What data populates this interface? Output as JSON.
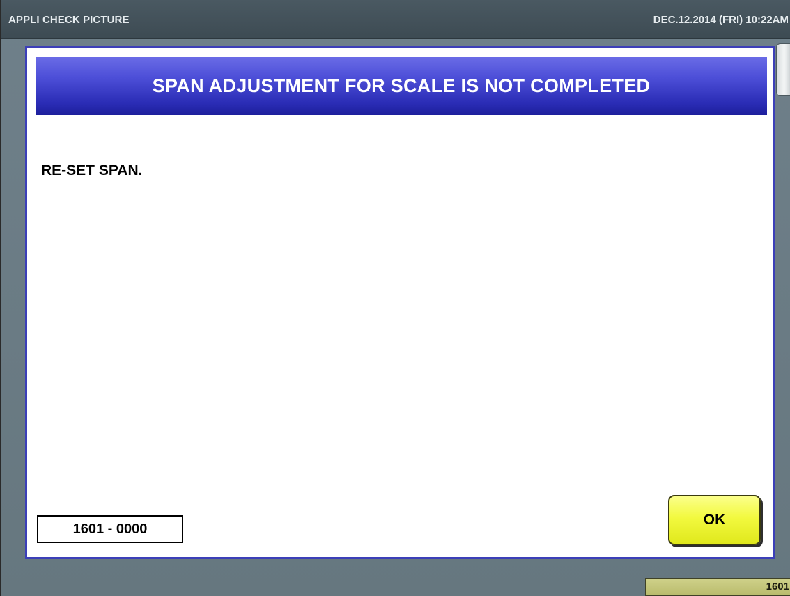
{
  "titlebar": {
    "app_title": "APPLI CHECK PICTURE",
    "datetime": "DEC.12.2014 (FRI)  10:22AM"
  },
  "dialog": {
    "title": "SPAN ADJUSTMENT FOR SCALE IS NOT COMPLETED",
    "message": "RE-SET SPAN.",
    "error_code": "1601 - 0000",
    "ok_label": "OK"
  },
  "footer": {
    "counter": "1601"
  },
  "colors": {
    "header_blue": "#3c3fd0",
    "ok_yellow": "#f2f93f",
    "background": "#6f808a"
  }
}
